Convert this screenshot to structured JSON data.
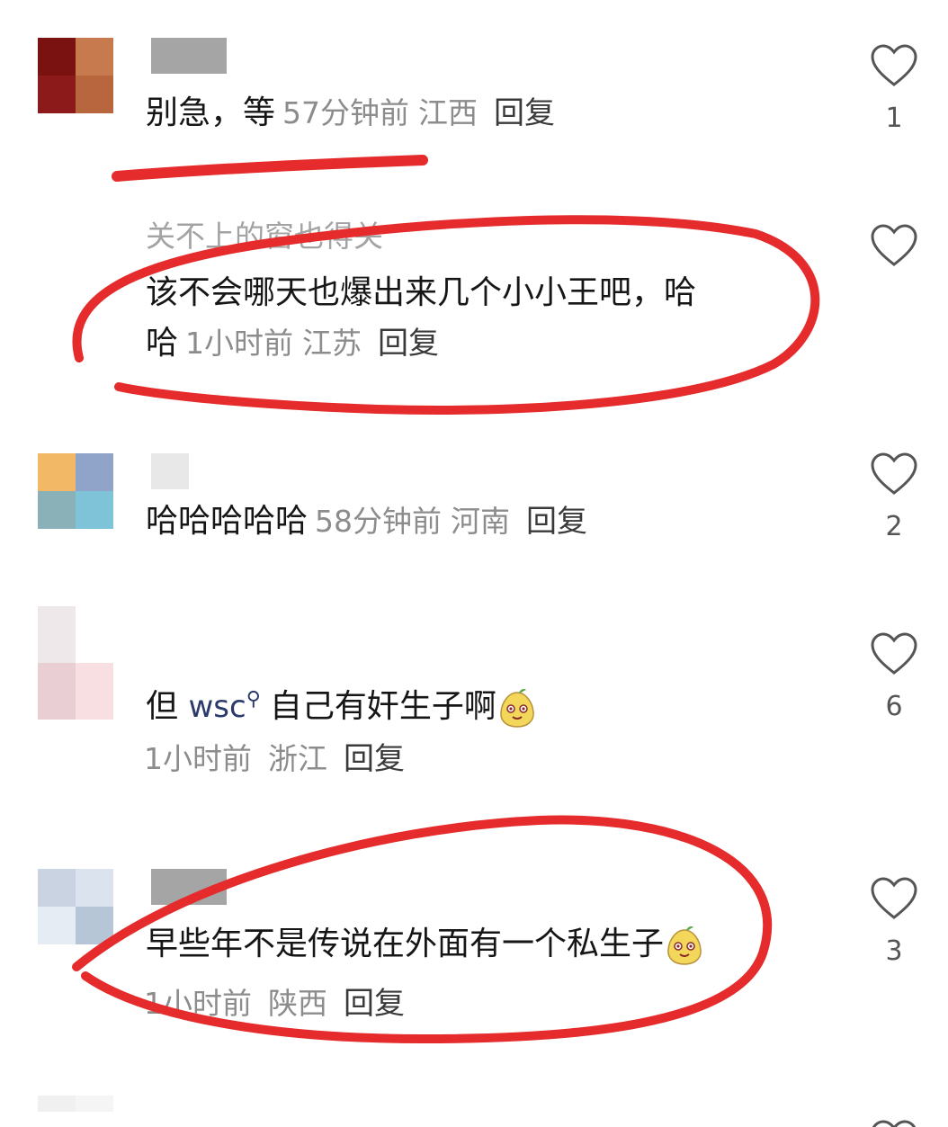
{
  "comments": [
    {
      "avatar_colors": [
        "#7a1212",
        "#c77a4e",
        "#8c1a1a",
        "#b8663d"
      ],
      "text": "别急，等",
      "time": "57分钟前",
      "location": "江西",
      "reply_label": "回复",
      "likes": "1"
    },
    {
      "username": "关不上的窗也得关",
      "text_line1": "该不会哪天也爆出来几个小小王吧，哈",
      "text_line2": "哈",
      "time": "1小时前",
      "location": "江苏",
      "reply_label": "回复"
    },
    {
      "avatar_colors": [
        "#f2b866",
        "#8fa4c8",
        "#8ab0b8",
        "#7fc3d8"
      ],
      "text": "哈哈哈哈哈",
      "time": "58分钟前",
      "location": "河南",
      "reply_label": "回复",
      "likes": "2"
    },
    {
      "avatar_colors": [
        "#efe8ea",
        "#ffffff",
        "#e9cfd4",
        "#f7dfe2"
      ],
      "text_prefix": "但",
      "link_text": "wsc",
      "text_suffix": "自己有奸生子啊",
      "time": "1小时前",
      "location": "浙江",
      "reply_label": "回复",
      "likes": "6"
    },
    {
      "avatar_colors": [
        "#c9d3e2",
        "#dbe3ee",
        "#e6ecf3",
        "#b7c6d6"
      ],
      "text": "早些年不是传说在外面有一个私生子",
      "time": "1小时前",
      "location": "陕西",
      "reply_label": "回复",
      "likes": "3"
    }
  ],
  "colors": {
    "annotation_red": "#e52b2b",
    "heart_outline": "#555555"
  },
  "icons": {
    "like": "heart-outline-icon",
    "emoji": "smiling-pear-emoji-icon",
    "search": "search-icon"
  }
}
